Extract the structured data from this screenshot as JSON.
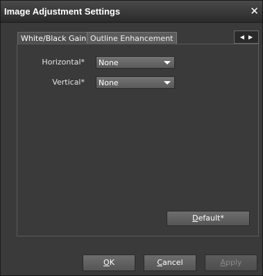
{
  "window": {
    "title": "Image Adjustment Settings",
    "close_glyph": "✕"
  },
  "tabs": [
    {
      "label": "White/Black Gain",
      "active": true
    },
    {
      "label": "Outline Enhancement",
      "active": false
    }
  ],
  "tab_scroll": {
    "left_glyph": "◀",
    "right_glyph": "▶"
  },
  "fields": {
    "horizontal": {
      "label": "Horizontal*",
      "value": "None"
    },
    "vertical": {
      "label": "Vertical*",
      "value": "None"
    }
  },
  "buttons": {
    "default": {
      "mnemonic": "D",
      "rest": "efault*"
    },
    "ok": {
      "mnemonic": "O",
      "rest": "K"
    },
    "cancel": {
      "mnemonic": "C",
      "rest": "ancel"
    },
    "apply": {
      "mnemonic": "A",
      "rest": "pply",
      "disabled": true
    }
  }
}
